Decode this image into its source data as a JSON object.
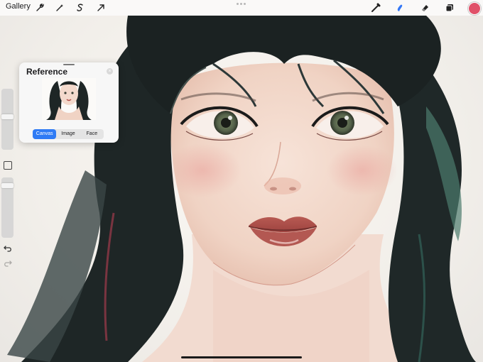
{
  "topbar": {
    "gallery_label": "Gallery",
    "left_tools": [
      {
        "icon": "wrench-icon",
        "label": "actions"
      },
      {
        "icon": "magic-wand-icon",
        "label": "adjustments"
      },
      {
        "icon": "selection-icon",
        "label": "selection"
      },
      {
        "icon": "arrow-icon",
        "label": "transform"
      }
    ],
    "right_tools": [
      {
        "icon": "brush-icon",
        "label": "paint"
      },
      {
        "icon": "smudge-icon",
        "label": "smudge"
      },
      {
        "icon": "eraser-icon",
        "label": "erase"
      },
      {
        "icon": "layers-icon",
        "label": "layers"
      }
    ],
    "current_color": "#e05169",
    "active_tool_color": "#3478f6"
  },
  "reference": {
    "title": "Reference",
    "tabs": [
      "Canvas",
      "Image",
      "Face"
    ],
    "active_tab": "Canvas"
  },
  "sidebar": {
    "brush_size": 0.55,
    "opacity": 0.9
  },
  "artwork": {
    "hair_color": "#1f2a2a",
    "skin_color": "#f3d9cc",
    "lip_color": "#b4524d",
    "eye_color": "#6b7a5a"
  }
}
